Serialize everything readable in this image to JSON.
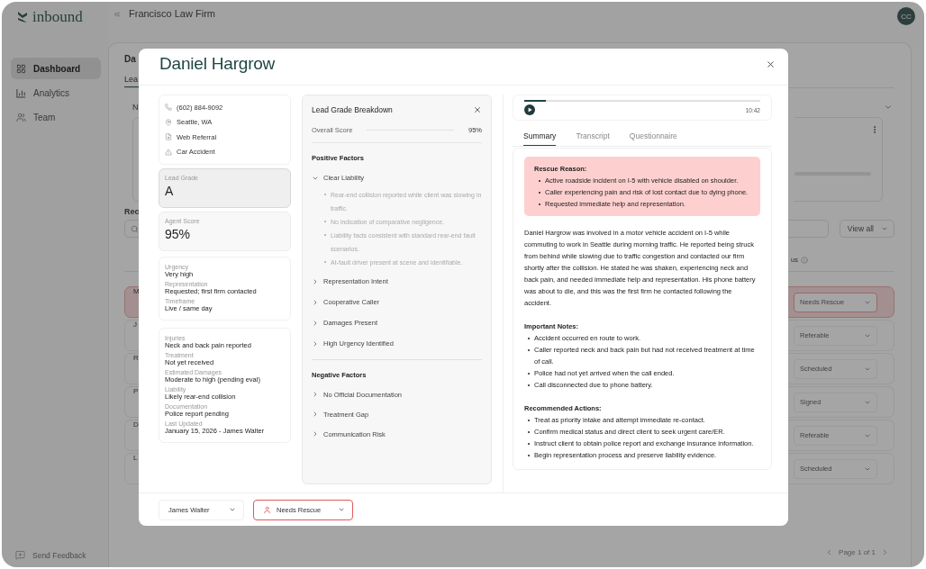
{
  "app": {
    "logo": "inbound",
    "firm": "Francisco Law Firm",
    "avatar": "CC",
    "nav": [
      {
        "kind": "dashboard",
        "label": "Dashboard",
        "selected": true
      },
      {
        "kind": "analytics",
        "label": "Analytics",
        "selected": false
      },
      {
        "kind": "team",
        "label": "Team",
        "selected": false
      }
    ],
    "feedback": "Send Feedback"
  },
  "background": {
    "heading": "Da",
    "tab": "Lea",
    "section": "N",
    "recent": "Rec",
    "view_all": "View all",
    "status_column": "us",
    "rows": [
      {
        "initial": "M",
        "status": "Needs Rescue",
        "flagged": true
      },
      {
        "initial": "J",
        "status": "Referable",
        "flagged": false
      },
      {
        "initial": "R",
        "status": "Scheduled",
        "flagged": false
      },
      {
        "initial": "P",
        "status": "Signed",
        "flagged": false
      },
      {
        "initial": "D",
        "status": "Referable",
        "flagged": false
      },
      {
        "initial": "L",
        "status": "Scheduled",
        "flagged": false
      }
    ],
    "pagination": "Page 1 of 1"
  },
  "modal": {
    "name": "Daniel Hargrow",
    "contact": [
      {
        "kind": "phone",
        "text": "(602) 884-9092"
      },
      {
        "kind": "location",
        "text": "Seattle, WA"
      },
      {
        "kind": "referral",
        "text": "Web Referral"
      },
      {
        "kind": "case",
        "text": "Car Accident"
      }
    ],
    "scores": [
      {
        "label": "Lead Grade",
        "value": "A",
        "selected": true
      },
      {
        "label": "Agent Score",
        "value": "95%",
        "selected": false
      }
    ],
    "details": [
      [
        {
          "label": "Urgency",
          "value": "Very high"
        },
        {
          "label": "Representation",
          "value": "Requested; first firm contacted"
        },
        {
          "label": "Timeframe",
          "value": "Live / same day"
        }
      ],
      [
        {
          "label": "Injuries",
          "value": "Neck and back pain reported"
        },
        {
          "label": "Treatment",
          "value": "Not yet received"
        },
        {
          "label": "Estimated Damages",
          "value": "Moderate to high (pending eval)"
        },
        {
          "label": "Liability",
          "value": "Likely rear-end collision"
        },
        {
          "label": "Documentation",
          "value": "Police report pending"
        },
        {
          "label": "Last Updated",
          "value": "January 15, 2026 - James Walter"
        }
      ]
    ],
    "breakdown": {
      "title": "Lead Grade Breakdown",
      "overall_label": "Overall Score",
      "overall_value": "95%",
      "groups": [
        {
          "title": "Positive Factors",
          "factors": [
            {
              "label": "Clear Liability",
              "expanded": true,
              "points": [
                "Rear-end collision reported while client was slowing in traffic.",
                "No indication of comparative negligence.",
                "Liability facts consistent with standard rear-end fault scenarios.",
                "At-fault driver present at scene and identifiable."
              ]
            },
            {
              "label": "Representation Intent",
              "expanded": false
            },
            {
              "label": "Cooperative Caller",
              "expanded": false
            },
            {
              "label": "Damages Present",
              "expanded": false
            },
            {
              "label": "High Urgency Identified",
              "expanded": false
            }
          ]
        },
        {
          "title": "Negative Factors",
          "factors": [
            {
              "label": "No Official Documentation",
              "expanded": false
            },
            {
              "label": "Treatment Gap",
              "expanded": false
            },
            {
              "label": "Communication Risk",
              "expanded": false
            }
          ]
        }
      ]
    },
    "player": {
      "level": 0.09,
      "duration": "10:42"
    },
    "tabs": [
      {
        "label": "Summary",
        "selected": true
      },
      {
        "label": "Transcript",
        "selected": false
      },
      {
        "label": "Questionnaire",
        "selected": false
      }
    ],
    "summary": {
      "rescue_title": "Rescue Reason:",
      "rescue_points": [
        "Active roadside incident on I-5 with vehicle disabled on shoulder.",
        "Caller experiencing pain and risk of lost contact due to dying phone.",
        "Requested immediate help and representation."
      ],
      "paragraph": "Daniel Hargrow was involved in a motor vehicle accident on I-5 while commuting to work in Seattle during morning traffic. He reported being struck from behind while slowing due to traffic congestion and contacted our firm shortly after the collision. He stated he was shaken, experiencing neck and back pain, and needed immediate help and representation. His phone battery was about to die, and this was the first firm he contacted following the accident.",
      "sections": [
        {
          "title": "Important Notes:",
          "points": [
            "Accident occurred en route to work.",
            "Caller reported neck and back pain but had not received treatment at time of call.",
            "Police had not yet arrived when the call ended.",
            "Call disconnected due to phone battery."
          ]
        },
        {
          "title": "Recommended Actions:",
          "points": [
            "Treat as priority intake and attempt immediate re-contact.",
            "Confirm medical status and direct client to seek urgent care/ER.",
            "Instruct client to obtain police report and exchange insurance information.",
            "Begin representation process and preserve liability evidence."
          ]
        }
      ]
    },
    "footer": {
      "assignee": "James Walter",
      "status": "Needs Rescue",
      "flagged": true
    }
  }
}
